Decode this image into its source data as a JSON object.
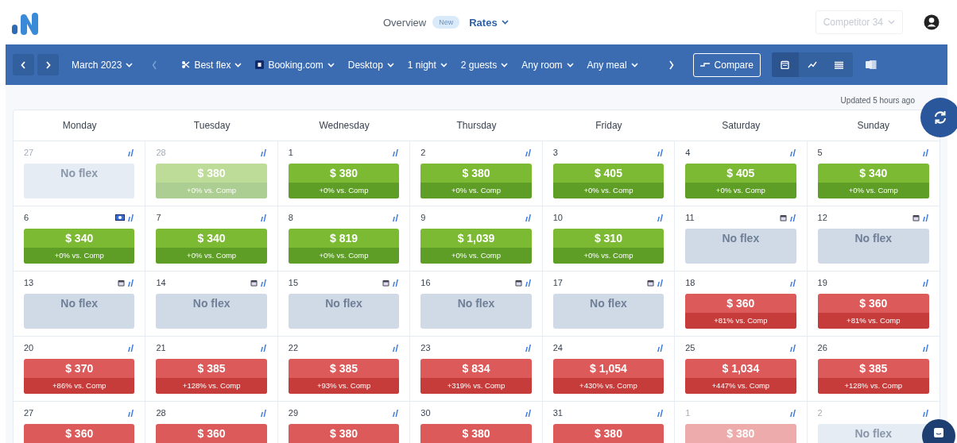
{
  "nav": {
    "items": [
      {
        "label": "Overview",
        "badge": "New",
        "selected": false
      },
      {
        "label": "Rates",
        "selected": true
      }
    ],
    "competitor": "Competitor 34"
  },
  "toolbar": {
    "month": "March 2023",
    "filters": [
      {
        "label": "Best flex",
        "kind": "rate"
      },
      {
        "label": "Booking.com",
        "kind": "channel"
      },
      {
        "label": "Desktop",
        "kind": "plain"
      },
      {
        "label": "1 night",
        "kind": "plain"
      },
      {
        "label": "2 guests",
        "kind": "plain"
      },
      {
        "label": "Any room",
        "kind": "plain"
      },
      {
        "label": "Any meal",
        "kind": "plain"
      }
    ],
    "compare": "Compare",
    "views": [
      {
        "kind": "calendar",
        "selected": true
      },
      {
        "kind": "graph",
        "selected": false
      },
      {
        "kind": "list",
        "selected": false
      }
    ]
  },
  "updated": "Updated 5 hours ago",
  "weekdays": [
    "Monday",
    "Tuesday",
    "Wednesday",
    "Thursday",
    "Friday",
    "Saturday",
    "Sunday"
  ],
  "weeks": [
    [
      {
        "day": "27",
        "outside": true,
        "kind": "none",
        "price": "No flex"
      },
      {
        "day": "28",
        "outside": true,
        "kind": "equal",
        "price": "$ 380",
        "diff": "+0% vs. Comp"
      },
      {
        "day": "1",
        "outside": false,
        "kind": "equal",
        "price": "$ 380",
        "diff": "+0% vs. Comp"
      },
      {
        "day": "2",
        "outside": false,
        "kind": "equal",
        "price": "$ 380",
        "diff": "+0% vs. Comp"
      },
      {
        "day": "3",
        "outside": false,
        "kind": "equal",
        "price": "$ 405",
        "diff": "+0% vs. Comp"
      },
      {
        "day": "4",
        "outside": false,
        "kind": "equal",
        "price": "$ 405",
        "diff": "+0% vs. Comp"
      },
      {
        "day": "5",
        "outside": false,
        "kind": "equal",
        "price": "$ 340",
        "diff": "+0% vs. Comp"
      }
    ],
    [
      {
        "day": "6",
        "outside": false,
        "kind": "equal",
        "price": "$ 340",
        "diff": "+0% vs. Comp",
        "flag": true
      },
      {
        "day": "7",
        "outside": false,
        "kind": "equal",
        "price": "$ 340",
        "diff": "+0% vs. Comp"
      },
      {
        "day": "8",
        "outside": false,
        "kind": "equal",
        "price": "$ 819",
        "diff": "+0% vs. Comp"
      },
      {
        "day": "9",
        "outside": false,
        "kind": "equal",
        "price": "$ 1,039",
        "diff": "+0% vs. Comp"
      },
      {
        "day": "10",
        "outside": false,
        "kind": "equal",
        "price": "$ 310",
        "diff": "+0% vs. Comp"
      },
      {
        "day": "11",
        "outside": false,
        "kind": "none",
        "price": "No flex",
        "event": true
      },
      {
        "day": "12",
        "outside": false,
        "kind": "none",
        "price": "No flex",
        "event": true
      }
    ],
    [
      {
        "day": "13",
        "outside": false,
        "kind": "none",
        "price": "No flex",
        "event": true
      },
      {
        "day": "14",
        "outside": false,
        "kind": "none",
        "price": "No flex",
        "event": true
      },
      {
        "day": "15",
        "outside": false,
        "kind": "none",
        "price": "No flex",
        "event": true
      },
      {
        "day": "16",
        "outside": false,
        "kind": "none",
        "price": "No flex",
        "event": true
      },
      {
        "day": "17",
        "outside": false,
        "kind": "none",
        "price": "No flex",
        "event": true
      },
      {
        "day": "18",
        "outside": false,
        "kind": "above",
        "price": "$ 360",
        "diff": "+81% vs. Comp"
      },
      {
        "day": "19",
        "outside": false,
        "kind": "above",
        "price": "$ 360",
        "diff": "+81% vs. Comp"
      }
    ],
    [
      {
        "day": "20",
        "outside": false,
        "kind": "above",
        "price": "$ 370",
        "diff": "+86% vs. Comp"
      },
      {
        "day": "21",
        "outside": false,
        "kind": "above",
        "price": "$ 385",
        "diff": "+128% vs. Comp"
      },
      {
        "day": "22",
        "outside": false,
        "kind": "above",
        "price": "$ 385",
        "diff": "+93% vs. Comp"
      },
      {
        "day": "23",
        "outside": false,
        "kind": "above",
        "price": "$ 834",
        "diff": "+319% vs. Comp"
      },
      {
        "day": "24",
        "outside": false,
        "kind": "above",
        "price": "$ 1,054",
        "diff": "+430% vs. Comp"
      },
      {
        "day": "25",
        "outside": false,
        "kind": "above",
        "price": "$ 1,034",
        "diff": "+447% vs. Comp"
      },
      {
        "day": "26",
        "outside": false,
        "kind": "above",
        "price": "$ 385",
        "diff": "+128% vs. Comp"
      }
    ],
    [
      {
        "day": "27",
        "outside": false,
        "kind": "above",
        "price": "$ 360"
      },
      {
        "day": "28",
        "outside": false,
        "kind": "above",
        "price": "$ 360"
      },
      {
        "day": "29",
        "outside": false,
        "kind": "above",
        "price": "$ 380"
      },
      {
        "day": "30",
        "outside": false,
        "kind": "above",
        "price": "$ 380"
      },
      {
        "day": "31",
        "outside": false,
        "kind": "above",
        "price": "$ 380"
      },
      {
        "day": "1",
        "outside": true,
        "kind": "above",
        "price": "$ 380"
      },
      {
        "day": "2",
        "outside": true,
        "kind": "none",
        "price": "No flex"
      }
    ]
  ]
}
